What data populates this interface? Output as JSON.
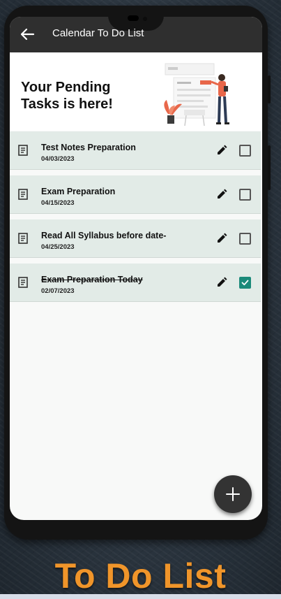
{
  "app": {
    "title": "Calendar To Do List"
  },
  "header": {
    "title": "Your Pending\nTasks is here!"
  },
  "tasks": [
    {
      "title": "Test Notes Preparation",
      "date": "04/03/2023",
      "completed": false
    },
    {
      "title": "Exam Preparation",
      "date": "04/15/2023",
      "completed": false
    },
    {
      "title": "Read All Syllabus before date-",
      "date": "04/25/2023",
      "completed": false
    },
    {
      "title": "Exam Preparation Today",
      "date": "02/07/2023",
      "completed": true
    }
  ],
  "banner": {
    "text": "To Do List"
  },
  "colors": {
    "accent": "#1b8a7a",
    "appbar": "#2f2f2f",
    "task_bg": "#e2ebe7",
    "banner": "#f0952a"
  },
  "icons": {
    "back": "arrow-left-icon",
    "task": "document-icon",
    "edit": "pencil-icon",
    "add": "plus-icon"
  }
}
